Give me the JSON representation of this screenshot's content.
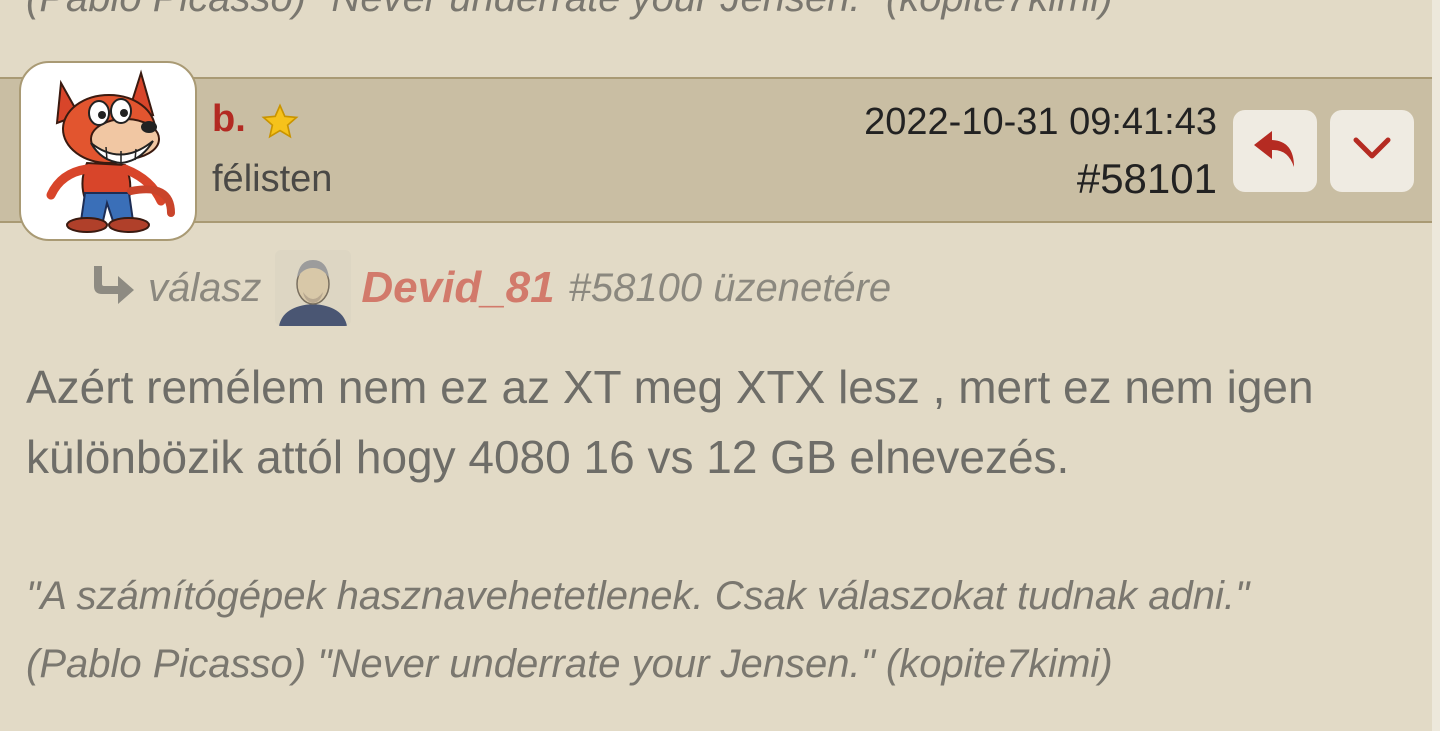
{
  "previous_signature": "(Pablo Picasso) \"Never underrate your Jensen.\" (kopite7kimi)",
  "post": {
    "author": "b.",
    "rank": "félisten",
    "datetime": "2022-10-31 09:41:43",
    "number": "#58101",
    "icons": {
      "avatar": "cartoon-fox-avatar",
      "rank_star": "star-icon",
      "reply": "reply-icon",
      "menu": "chevron-down-icon"
    },
    "colors": {
      "author": "#b32a22",
      "header_bg": "#c9bea3",
      "page_bg": "#e2dac6",
      "reply_user": "#d27a6b"
    }
  },
  "reply_to": {
    "prefix": "válasz",
    "user": "Devid_81",
    "suffix": "#58100 üzenetére"
  },
  "body": "Azért remélem nem ez az XT meg XTX lesz , mert ez nem igen különbözik attól hogy 4080 16 vs 12 GB elnevezés.",
  "signature": {
    "line1": "\"A számítógépek hasznavehetetlenek. Csak válaszokat tudnak adni.\"",
    "line2": "(Pablo Picasso) \"Never underrate your Jensen.\" (kopite7kimi)"
  }
}
